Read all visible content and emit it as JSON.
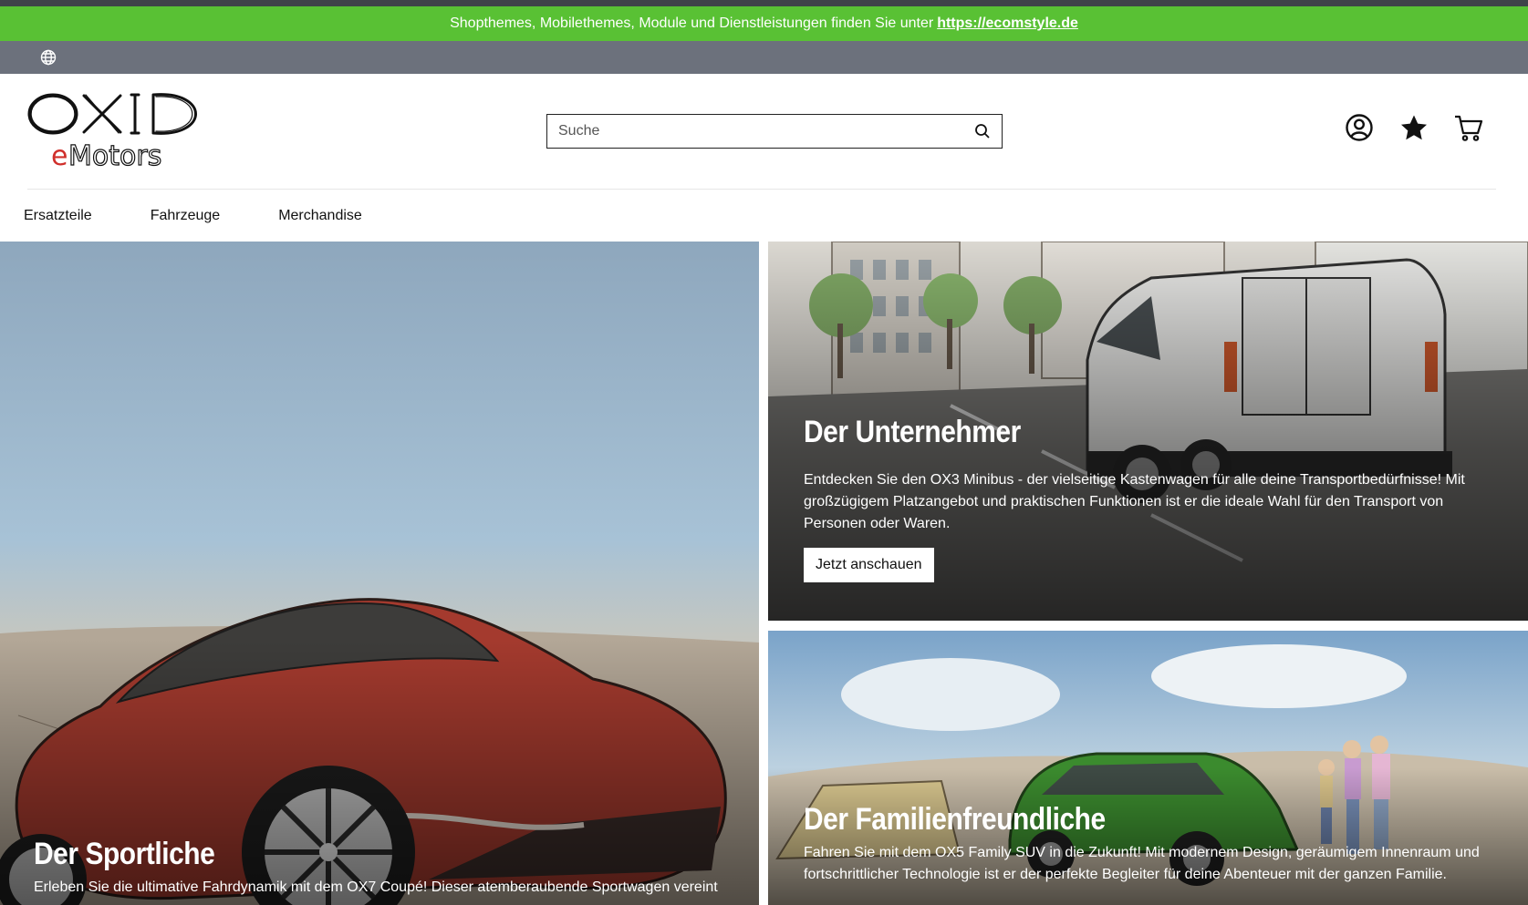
{
  "promo": {
    "text": "Shopthemes, Mobilethemes, Module und Dienstleistungen finden Sie unter",
    "link": "https://ecomstyle.de",
    "bg_color": "#59c134"
  },
  "lang_icon": "globe-icon",
  "logo": {
    "line1": "OXID",
    "line2_accent": "e",
    "line2_rest": "Motors"
  },
  "search": {
    "placeholder": "Suche",
    "value": ""
  },
  "header_icons": [
    "account-icon",
    "wishlist-star-icon",
    "cart-icon"
  ],
  "nav": {
    "items": [
      "Ersatzteile",
      "Fahrzeuge",
      "Merchandise"
    ]
  },
  "tiles": [
    {
      "title": "Der Sportliche",
      "text": "Erleben Sie die ultimative Fahrdynamik mit dem OX7 Coupé! Dieser atemberaubende Sportwagen vereint"
    },
    {
      "title": "Der Unternehmer",
      "text": "Entdecken Sie den OX3 Minibus - der vielseitige Kastenwagen für alle deine Transportbedürfnisse! Mit großzügigem Platzangebot und praktischen Funktionen ist er die ideale Wahl für den Transport von Personen oder Waren.",
      "button": "Jetzt anschauen"
    },
    {
      "title": "Der Familienfreundliche",
      "text": "Fahren Sie mit dem OX5 Family SUV in die Zukunft! Mit modernem Design, geräumigem Innenraum und fortschrittlicher Technologie ist er der perfekte Begleiter für deine Abenteuer mit der ganzen Familie."
    }
  ]
}
